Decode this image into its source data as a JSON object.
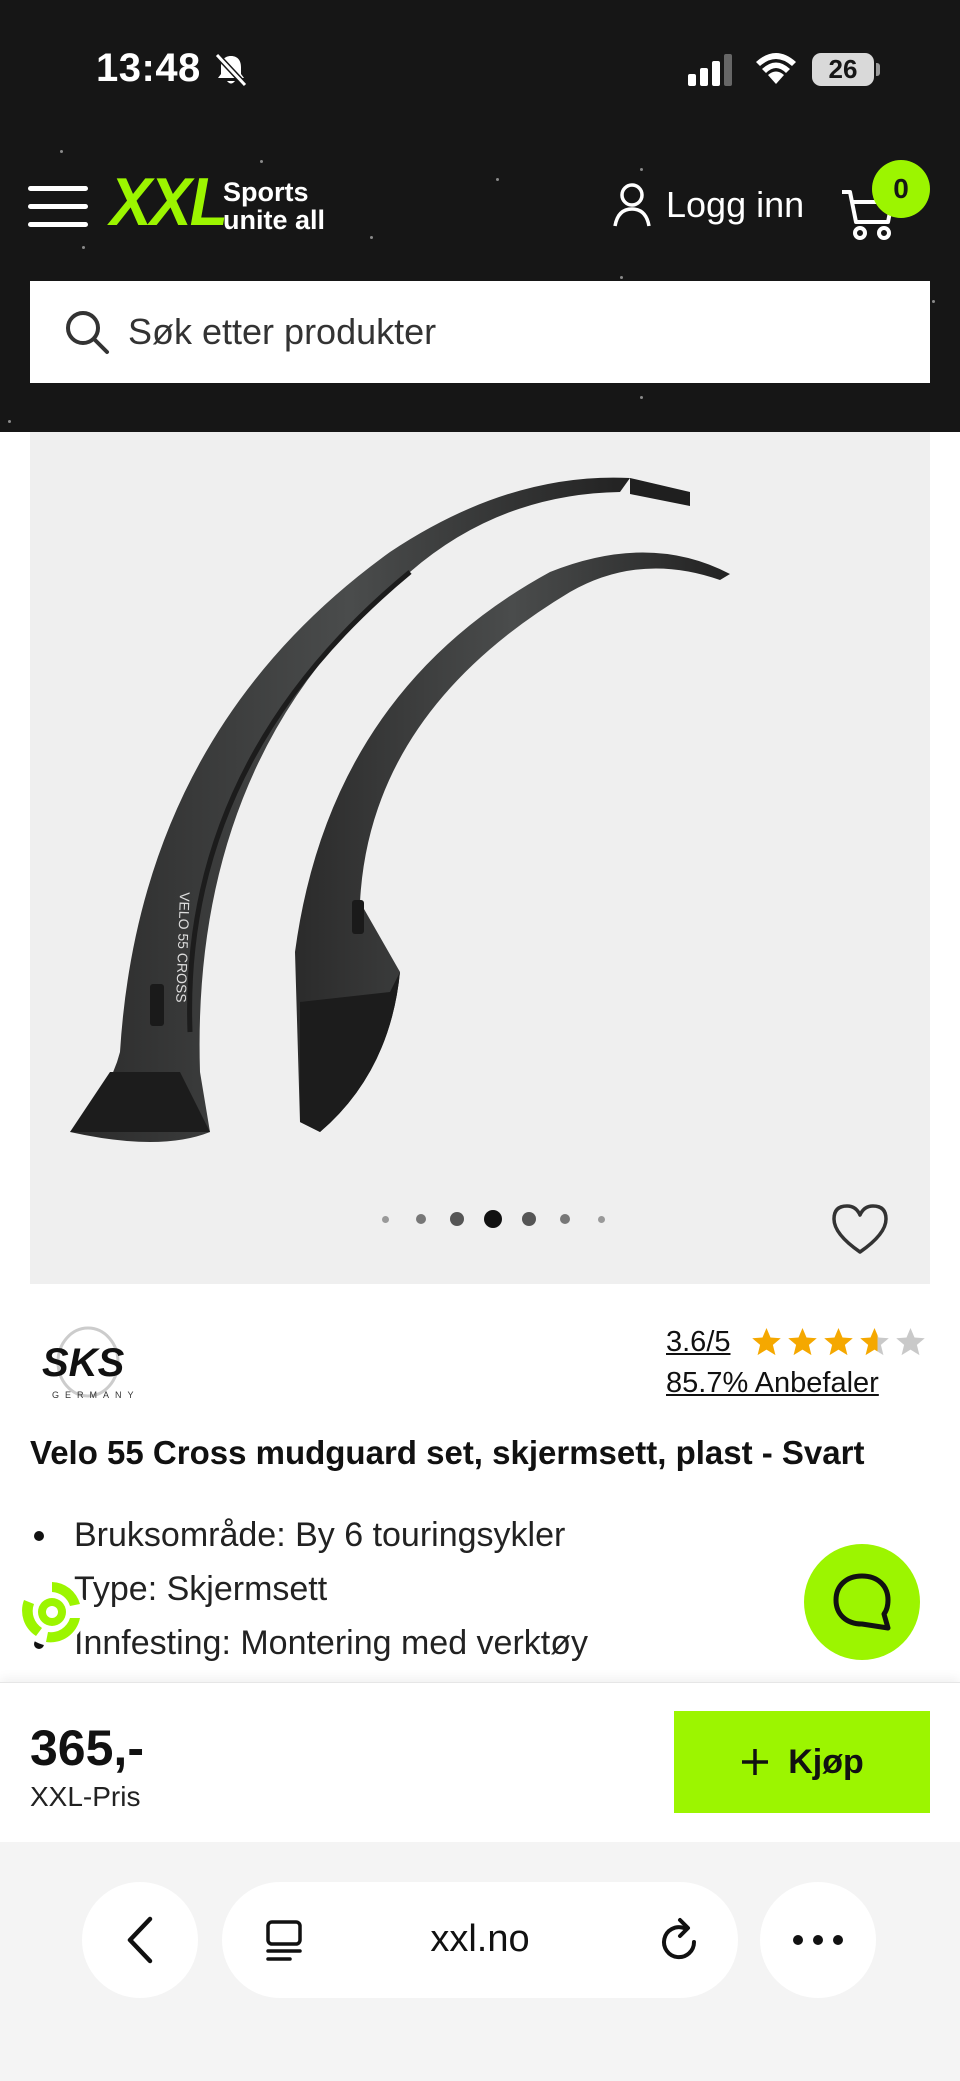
{
  "status_bar": {
    "time": "13:48",
    "battery": "26"
  },
  "header": {
    "logo_text": "XXL",
    "tagline_line1": "Sports",
    "tagline_line2": "unite all",
    "login_label": "Logg inn",
    "cart_count": "0",
    "brand_color": "#9cf500"
  },
  "search": {
    "placeholder": "Søk etter produkter"
  },
  "gallery": {
    "dot_count": 7,
    "active_dot": 3
  },
  "product": {
    "brand_logo_text": "SKS",
    "brand_logo_sub": "GERMANY",
    "rating": "3.6/5",
    "rating_value": 3.6,
    "rating_max": 5,
    "recommend": "85.7% Anbefaler",
    "title": "Velo 55 Cross mudguard set, skjermsett, plast - Svart",
    "features": [
      "Bruksområde: By 6 touringsykler",
      "Type: Skjermsett",
      "Innfesting: Montering med verktøy"
    ],
    "price": "365,-",
    "price_label": "XXL-Pris",
    "buy_label": "Kjøp"
  },
  "browser": {
    "url": "xxl.no"
  }
}
